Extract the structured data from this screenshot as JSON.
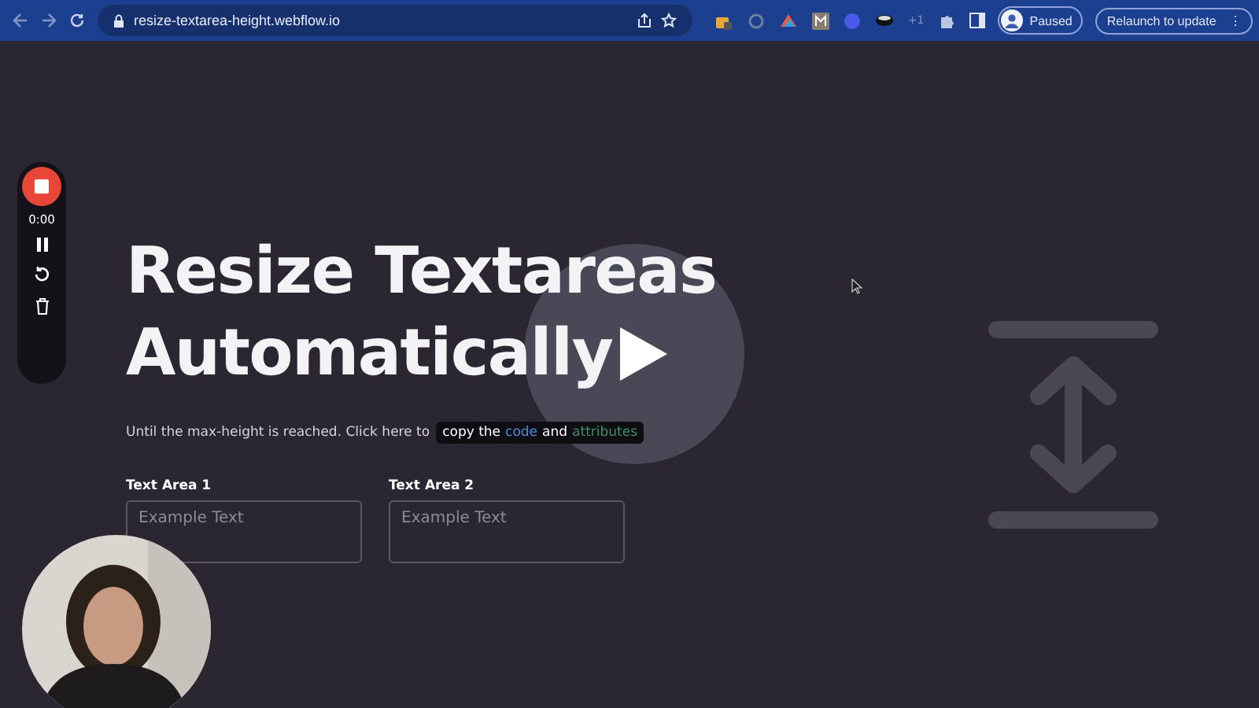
{
  "browser": {
    "url": "resize-textarea-height.webflow.io",
    "extension_count": "+1",
    "profile_status": "Paused",
    "update_button": "Relaunch to update",
    "menu": "⋮"
  },
  "recorder": {
    "time": "0:00"
  },
  "page": {
    "title_lines": [
      "Resize Textareas",
      "Automatically"
    ],
    "subtitle": "Until the max-height is reached. Click here to",
    "copy_chip": [
      {
        "text": "copy the",
        "color": "#ffffff"
      },
      {
        "text": "code",
        "color": "#4a8fd9"
      },
      {
        "text": "and",
        "color": "#ffffff"
      },
      {
        "text": "attributes",
        "color": "#3f8f6a"
      }
    ],
    "fields": [
      {
        "label": "Text Area 1",
        "placeholder": "Example Text"
      },
      {
        "label": "Text Area 2",
        "placeholder": "Example Text"
      }
    ]
  }
}
